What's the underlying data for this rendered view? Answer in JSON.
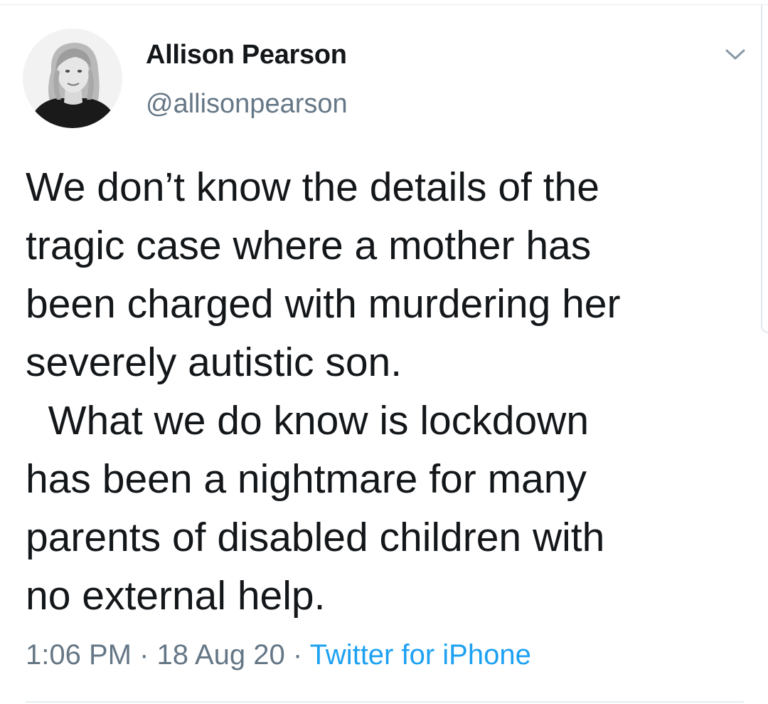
{
  "tweet": {
    "author": {
      "display_name": "Allison Pearson",
      "handle": "@allisonpearson"
    },
    "text_lines": [
      "We don’t know the details of the",
      "tragic case where a mother has",
      "been charged with murdering her",
      "severely autistic son.",
      "  What we do know is lockdown",
      "has been a nightmare for many",
      "parents of disabled children with",
      "no external help."
    ],
    "meta": {
      "time": "1:06 PM",
      "separator": "·",
      "date": "18 Aug 20",
      "source": "Twitter for iPhone"
    }
  },
  "icons": {
    "menu": "chevron-down-icon",
    "avatar": "avatar"
  },
  "colors": {
    "text": "#14171a",
    "secondary": "#657786",
    "link": "#1da1f2",
    "divider": "#e6ecf0"
  }
}
